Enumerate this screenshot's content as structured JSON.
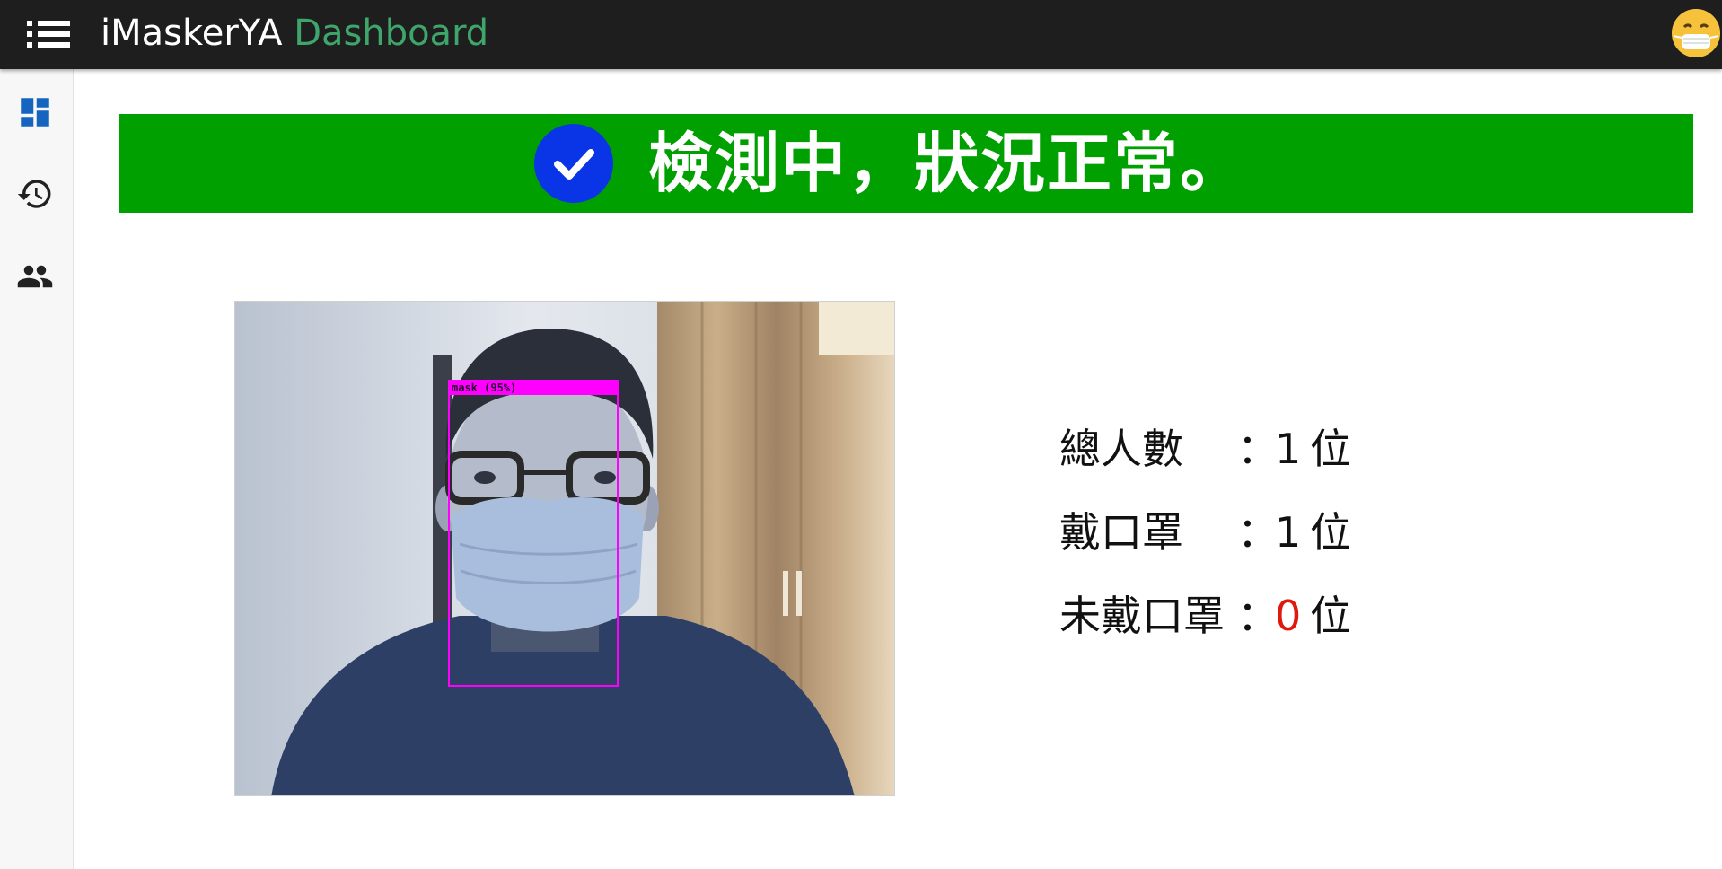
{
  "header": {
    "app_name": "iMaskerYA",
    "app_suffix": "Dashboard",
    "menu_icon": "menu-list-icon",
    "avatar_icon": "mask-face-emoji-icon"
  },
  "sidebar": {
    "items": [
      {
        "icon": "dashboard-icon",
        "color": "#1565c0"
      },
      {
        "icon": "history-icon",
        "color": "#222222"
      },
      {
        "icon": "people-icon",
        "color": "#222222"
      }
    ]
  },
  "status_banner": {
    "message": "檢測中，狀況正常。",
    "background_color": "#00a000",
    "icon": "check-circle-icon",
    "icon_color": "#0a35e6"
  },
  "camera_feed": {
    "detection_label": "mask (95%)",
    "box_color": "#ff00ff"
  },
  "stats": {
    "total": {
      "label": "總人數",
      "colon": "：",
      "value": "1",
      "unit": "位"
    },
    "masked": {
      "label": "戴口罩",
      "colon": "：",
      "value": "1",
      "unit": "位"
    },
    "unmasked": {
      "label": "未戴口罩",
      "colon": "：",
      "value": "0",
      "unit": "位",
      "value_color": "#e0190e"
    }
  }
}
